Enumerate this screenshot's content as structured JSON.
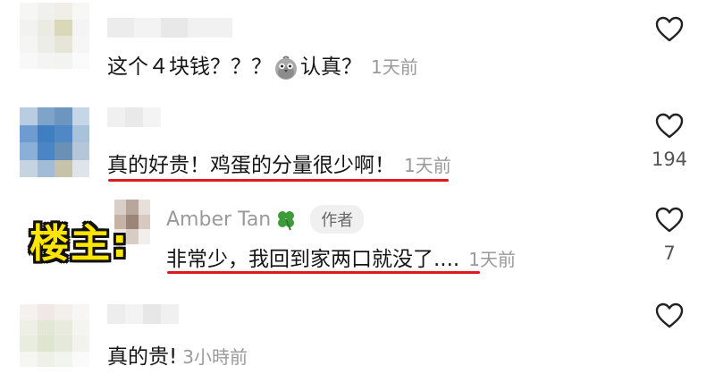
{
  "comments": [
    {
      "text": "这个４块钱？？？",
      "text_after_emoji": "认真？",
      "emoji": "pigeon-emoji",
      "time": "1天前",
      "likes": ""
    },
    {
      "text": "真的好贵！鸡蛋的分量很少啊！",
      "time": "1天前",
      "likes": "194"
    },
    {
      "author": "Amber Tan",
      "author_emoji": "four-leaf-clover",
      "badge": "作者",
      "text": "非常少，我回到家两口就没了....",
      "time": "1天前",
      "likes": "7",
      "overlay_label": "楼主:"
    },
    {
      "text": "真的贵!",
      "time": "3小時前",
      "likes": ""
    }
  ],
  "colors": {
    "underline": "#e0171b",
    "label_fill": "#ffe600",
    "time_gray": "#9a9a9a"
  }
}
